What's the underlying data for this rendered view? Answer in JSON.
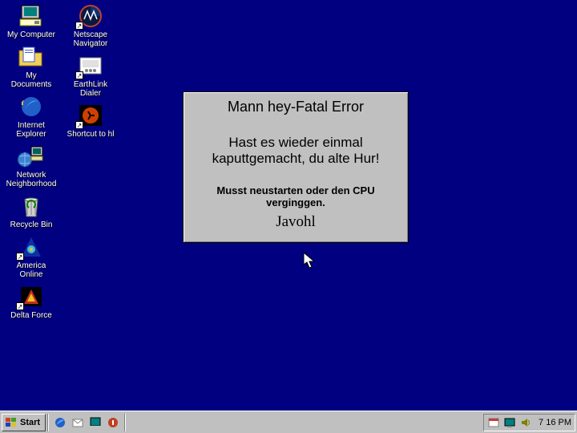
{
  "desktop_icons_col1": [
    {
      "label": "My Computer",
      "name": "my-computer",
      "shortcut": false
    },
    {
      "label": "My Documents",
      "name": "my-documents",
      "shortcut": false
    },
    {
      "label": "Internet Explorer",
      "name": "internet-explorer",
      "shortcut": false
    },
    {
      "label": "Network Neighborhood",
      "name": "network-neighborhood",
      "shortcut": false
    },
    {
      "label": "Recycle Bin",
      "name": "recycle-bin",
      "shortcut": false
    },
    {
      "label": "America Online",
      "name": "america-online",
      "shortcut": true
    },
    {
      "label": "Delta Force",
      "name": "delta-force",
      "shortcut": true
    }
  ],
  "desktop_icons_col2": [
    {
      "label": "Netscape Navigator",
      "name": "netscape-navigator",
      "shortcut": true
    },
    {
      "label": "EarthLink Dialer",
      "name": "earthlink-dialer",
      "shortcut": true
    },
    {
      "label": "Shortcut to hl",
      "name": "shortcut-hl",
      "shortcut": true
    }
  ],
  "dialog": {
    "title": "Mann hey-Fatal Error",
    "message": "Hast es wieder einmal kaputtgemacht, du alte Hur!",
    "sub": "Musst neustarten oder den CPU verginggen.",
    "button": "Javohl"
  },
  "taskbar": {
    "start": "Start",
    "clock": "7 16 PM"
  }
}
